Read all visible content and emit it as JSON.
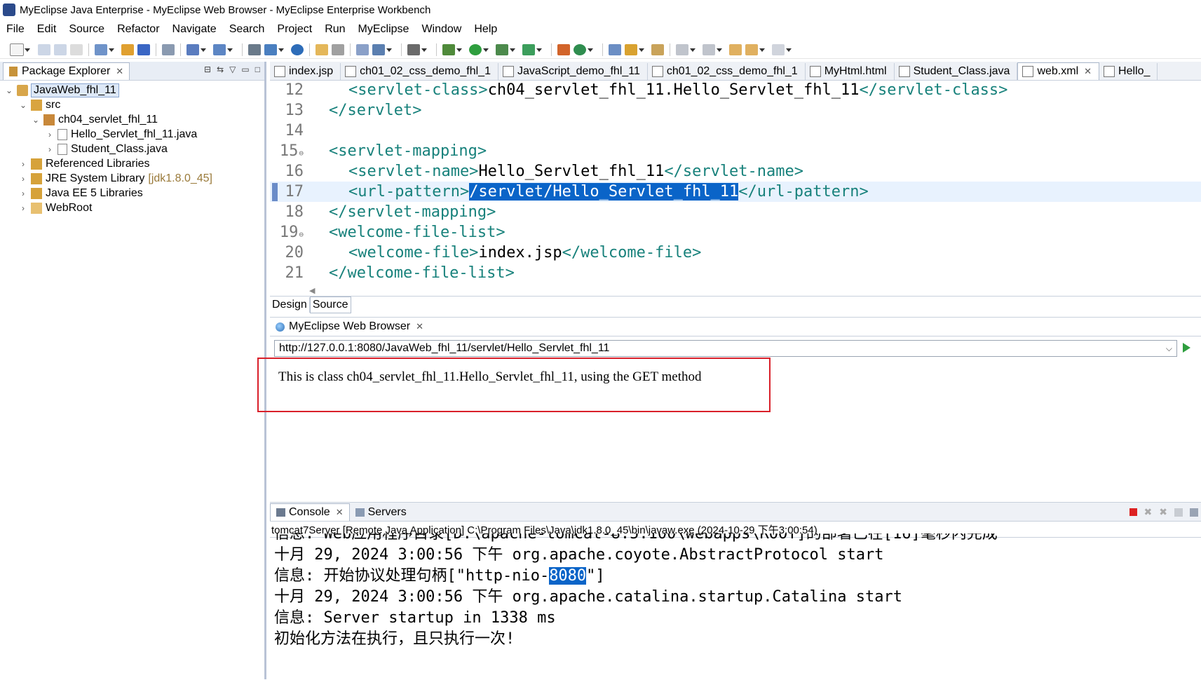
{
  "window": {
    "title": "MyEclipse Java Enterprise - MyEclipse Web Browser - MyEclipse Enterprise Workbench"
  },
  "menu": [
    "File",
    "Edit",
    "Source",
    "Refactor",
    "Navigate",
    "Search",
    "Project",
    "Run",
    "MyEclipse",
    "Window",
    "Help"
  ],
  "package_explorer": {
    "title": "Package Explorer",
    "project": "JavaWeb_fhl_11",
    "src": "src",
    "package": "ch04_servlet_fhl_11",
    "file1": "Hello_Servlet_fhl_11.java",
    "file2": "Student_Class.java",
    "ref_libs": "Referenced Libraries",
    "jre": "JRE System Library",
    "jre_decor": "[jdk1.8.0_45]",
    "javaee": "Java EE 5 Libraries",
    "webroot": "WebRoot"
  },
  "editor": {
    "tabs": [
      "index.jsp",
      "ch01_02_css_demo_fhl_1",
      "JavaScript_demo_fhl_11",
      "ch01_02_css_demo_fhl_1",
      "MyHtml.html",
      "Student_Class.java",
      "web.xml",
      "Hello_"
    ],
    "active_tab": "web.xml",
    "lines": {
      "l12": {
        "num": "12",
        "open": "<servlet-class>",
        "text": "ch04_servlet_fhl_11.Hello_Servlet_fhl_11",
        "close": "</servlet-class>"
      },
      "l13": {
        "num": "13",
        "tag": "</servlet>"
      },
      "l14": {
        "num": "14"
      },
      "l15": {
        "num": "15",
        "tag": "<servlet-mapping>"
      },
      "l16": {
        "num": "16",
        "open": "<servlet-name>",
        "text": "Hello_Servlet_fhl_11",
        "close": "</servlet-name>"
      },
      "l17": {
        "num": "17",
        "open": "<url-pattern>",
        "text": "/servlet/Hello_Servlet_fhl_11",
        "close": "</url-pattern>"
      },
      "l18": {
        "num": "18",
        "tag": "</servlet-mapping>"
      },
      "l19": {
        "num": "19",
        "tag": "<welcome-file-list>"
      },
      "l20": {
        "num": "20",
        "open": "<welcome-file>",
        "text": "index.jsp",
        "close": "</welcome-file>"
      },
      "l21": {
        "num": "21",
        "tag": "</welcome-file-list>"
      }
    },
    "design_tab": "Design",
    "source_tab": "Source"
  },
  "browser": {
    "title": "MyEclipse Web Browser",
    "url": "http://127.0.0.1:8080/JavaWeb_fhl_11/servlet/Hello_Servlet_fhl_11",
    "body_text": "This is class ch04_servlet_fhl_11.Hello_Servlet_fhl_11, using the GET method"
  },
  "console": {
    "tab": "Console",
    "servers_tab": "Servers",
    "description": "tomcat7Server [Remote Java Application] C:\\Program Files\\Java\\jdk1.8.0_45\\bin\\javaw.exe (2024-10-29 下午3:00:54)",
    "line0": "信息: Web应用程序目录[D:\\apache-tomcat-8.5.100\\webapps\\ROOT]的部署已在[16]毫秒内完成",
    "line1": "十月 29, 2024 3:00:56 下午 org.apache.coyote.AbstractProtocol start",
    "line2_pre": "信息: 开始协议处理句柄[\"http-nio-",
    "line2_hl": "8080",
    "line2_post": "\"]",
    "line3": "十月 29, 2024 3:00:56 下午 org.apache.catalina.startup.Catalina start",
    "line4": "信息: Server startup in 1338 ms",
    "line5": "初始化方法在执行，且只执行一次!"
  },
  "colors": {
    "xml_tag": "#17817b",
    "selection": "#0a64c8",
    "highlight_line": "#e8f2fe",
    "annotation_box": "#d9202a"
  }
}
